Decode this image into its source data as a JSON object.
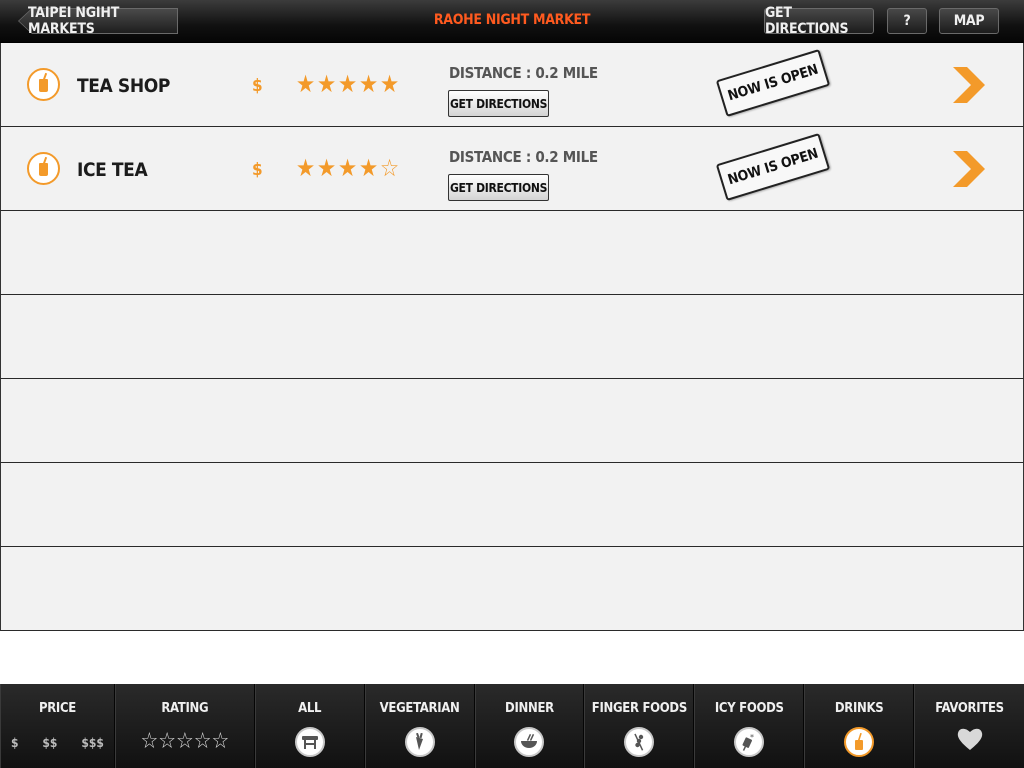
{
  "header": {
    "back_label": "TAIPEI NGIHT MARKETS",
    "title": "RAOHE NIGHT MARKET",
    "directions_label": "GET DIRECTIONS",
    "help_label": "?",
    "map_label": "MAP"
  },
  "colors": {
    "accent": "#f39a2a",
    "title": "#ff5a1f"
  },
  "list": {
    "rows": [
      {
        "name": "TEA SHOP",
        "icon": "drink-cup-icon",
        "price": "$",
        "rating": 5,
        "distance": "DISTANCE : 0.2 MILE",
        "directions_label": "GET DIRECTIONS",
        "status": "NOW IS OPEN"
      },
      {
        "name": "ICE TEA",
        "icon": "drink-cup-icon",
        "price": "$",
        "rating": 4,
        "distance": "DISTANCE : 0.2 MILE",
        "directions_label": "GET DIRECTIONS",
        "status": "NOW IS OPEN"
      }
    ],
    "empty_rows": 5
  },
  "tabbar": {
    "price": {
      "label": "PRICE",
      "options": [
        "$",
        "$$",
        "$$$"
      ]
    },
    "rating": {
      "label": "RATING",
      "stars": 5
    },
    "categories": [
      {
        "label": "ALL",
        "icon": "table-icon",
        "active": false
      },
      {
        "label": "VEGETARIAN",
        "icon": "carrot-icon",
        "active": false
      },
      {
        "label": "DINNER",
        "icon": "bowl-icon",
        "active": false
      },
      {
        "label": "FINGER FOODS",
        "icon": "skewer-icon",
        "active": false
      },
      {
        "label": "ICY FOODS",
        "icon": "shaved-ice-icon",
        "active": false
      },
      {
        "label": "DRINKS",
        "icon": "drink-cup-icon",
        "active": true
      },
      {
        "label": "FAVORITES",
        "icon": "heart-icon",
        "active": false
      }
    ]
  }
}
